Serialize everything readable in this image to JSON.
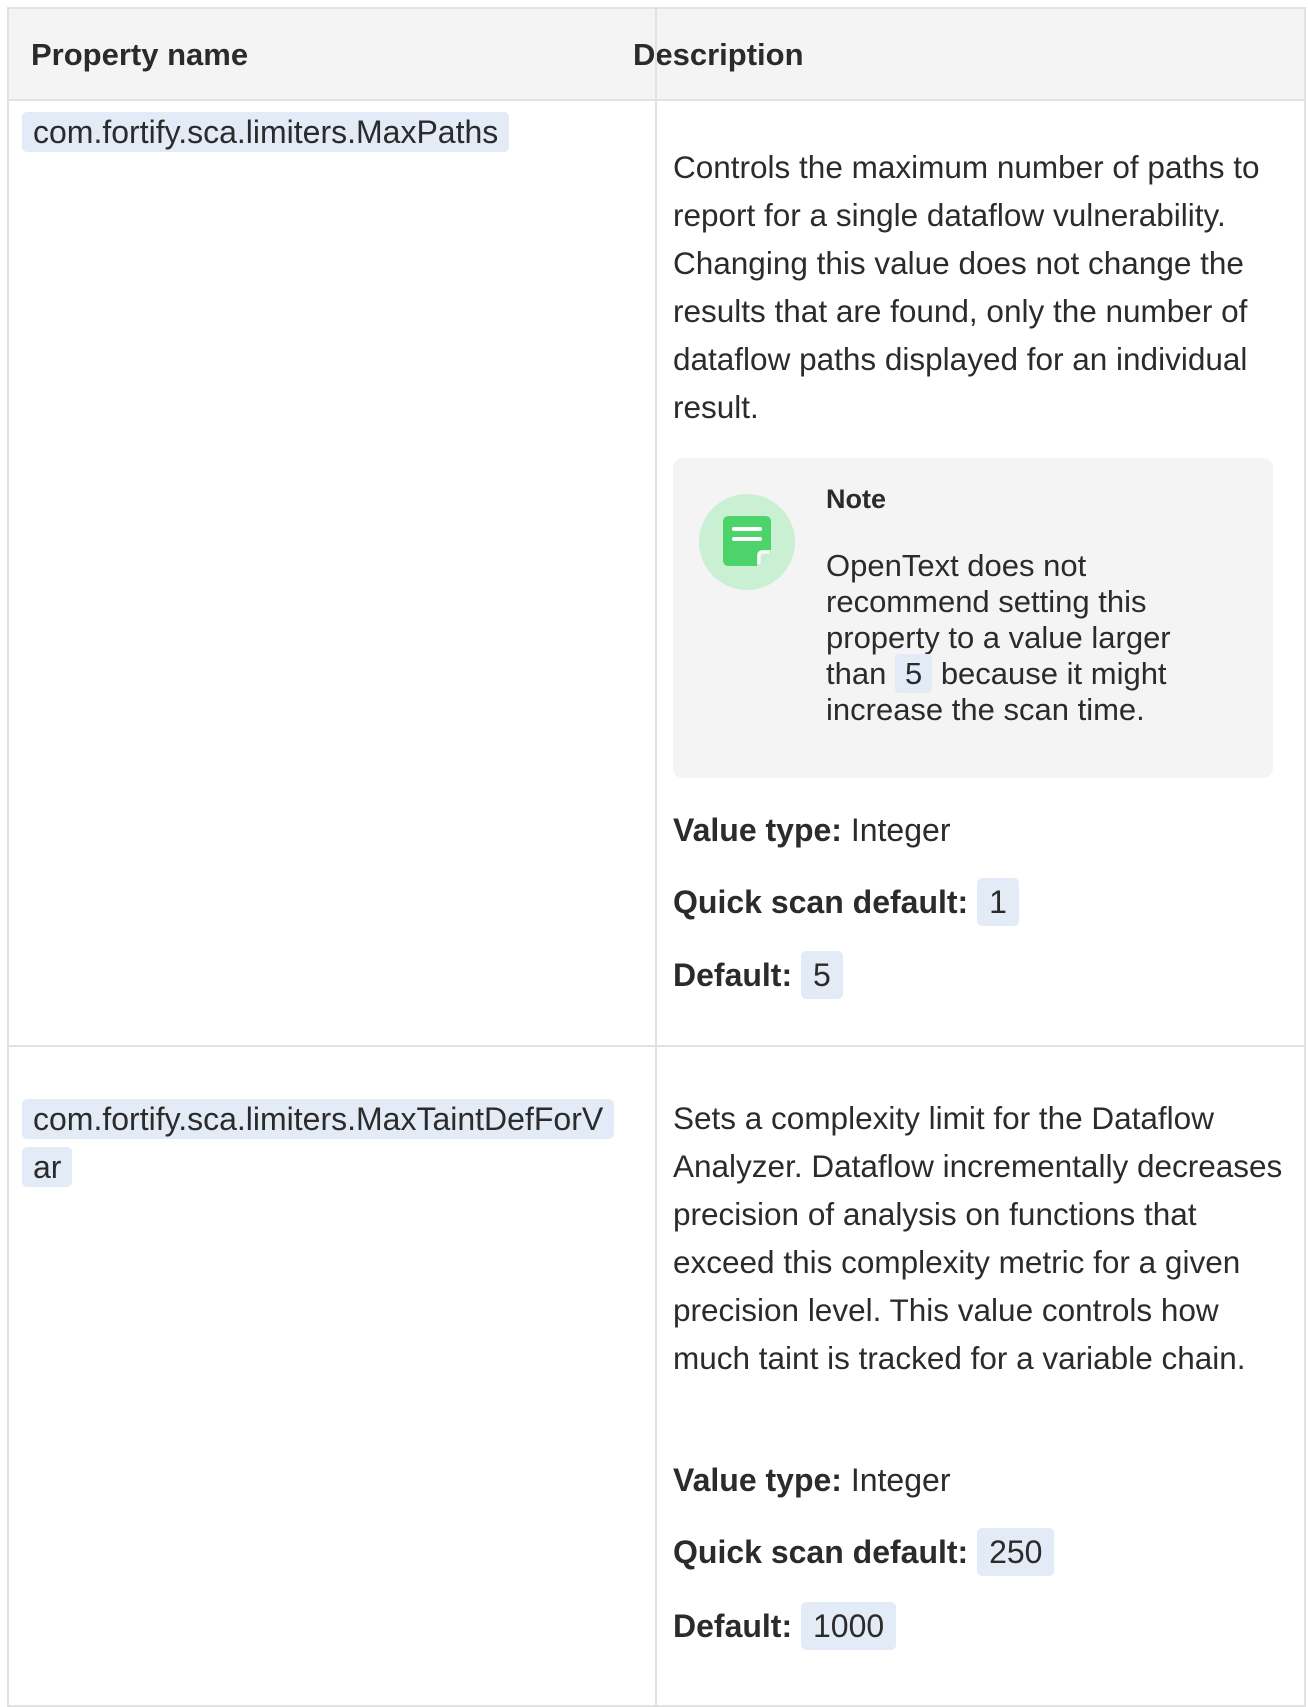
{
  "table": {
    "headers": {
      "property": "Property name",
      "description": "Description"
    },
    "rows": [
      {
        "property": "com.fortify.sca.limiters.MaxPaths",
        "description": "Controls the maximum number of paths to report for a single dataflow vulnerability. Changing this value does not change the results that are found, only the number of dataflow paths displayed for an individual result.",
        "note": {
          "title": "Note",
          "text_before": "OpenText does not recommend setting this property to a value larger than ",
          "code": "5",
          "text_after": " because it might increase the scan time."
        },
        "value_type_label": "Value type:",
        "value_type": "Integer",
        "quick_scan_label": "Quick scan default:",
        "quick_scan_default": "1",
        "default_label": "Default:",
        "default": "5"
      },
      {
        "property": "com.fortify.sca.limiters.MaxTaintDefForVar",
        "description": "Sets a complexity limit for the Dataflow Analyzer. Dataflow incrementally decreases precision of analysis on functions that exceed this complexity metric for a given precision level. This value controls how much taint is tracked for a variable chain.",
        "value_type_label": "Value type:",
        "value_type": "Integer",
        "quick_scan_label": "Quick scan default:",
        "quick_scan_default": "250",
        "default_label": "Default:",
        "default": "1000"
      }
    ]
  },
  "icons": {
    "note": "note-icon"
  },
  "colors": {
    "code_bg": "#e3ebf7",
    "note_bg": "#f4f4f4",
    "note_icon": "#4cd36a",
    "note_icon_circle": "#c9f0d3"
  }
}
